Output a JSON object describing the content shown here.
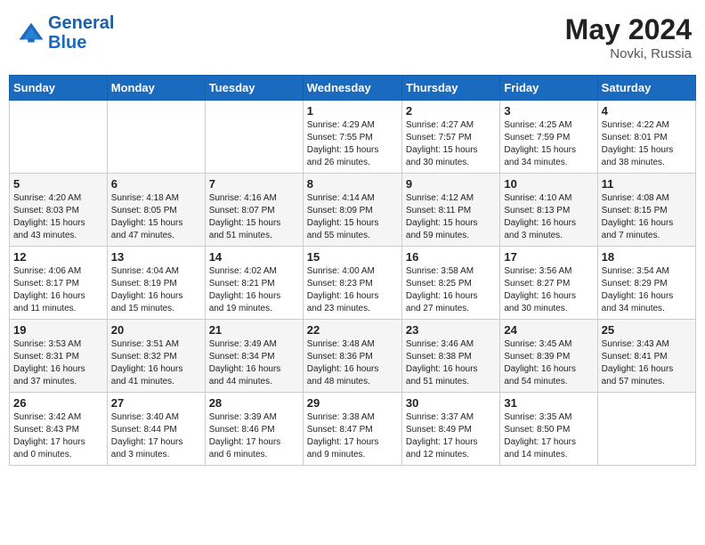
{
  "header": {
    "logo_line1": "General",
    "logo_line2": "Blue",
    "title": "May 2024",
    "subtitle": "Novki, Russia"
  },
  "columns": [
    "Sunday",
    "Monday",
    "Tuesday",
    "Wednesday",
    "Thursday",
    "Friday",
    "Saturday"
  ],
  "weeks": [
    [
      {
        "day": "",
        "info": ""
      },
      {
        "day": "",
        "info": ""
      },
      {
        "day": "",
        "info": ""
      },
      {
        "day": "1",
        "info": "Sunrise: 4:29 AM\nSunset: 7:55 PM\nDaylight: 15 hours\nand 26 minutes."
      },
      {
        "day": "2",
        "info": "Sunrise: 4:27 AM\nSunset: 7:57 PM\nDaylight: 15 hours\nand 30 minutes."
      },
      {
        "day": "3",
        "info": "Sunrise: 4:25 AM\nSunset: 7:59 PM\nDaylight: 15 hours\nand 34 minutes."
      },
      {
        "day": "4",
        "info": "Sunrise: 4:22 AM\nSunset: 8:01 PM\nDaylight: 15 hours\nand 38 minutes."
      }
    ],
    [
      {
        "day": "5",
        "info": "Sunrise: 4:20 AM\nSunset: 8:03 PM\nDaylight: 15 hours\nand 43 minutes."
      },
      {
        "day": "6",
        "info": "Sunrise: 4:18 AM\nSunset: 8:05 PM\nDaylight: 15 hours\nand 47 minutes."
      },
      {
        "day": "7",
        "info": "Sunrise: 4:16 AM\nSunset: 8:07 PM\nDaylight: 15 hours\nand 51 minutes."
      },
      {
        "day": "8",
        "info": "Sunrise: 4:14 AM\nSunset: 8:09 PM\nDaylight: 15 hours\nand 55 minutes."
      },
      {
        "day": "9",
        "info": "Sunrise: 4:12 AM\nSunset: 8:11 PM\nDaylight: 15 hours\nand 59 minutes."
      },
      {
        "day": "10",
        "info": "Sunrise: 4:10 AM\nSunset: 8:13 PM\nDaylight: 16 hours\nand 3 minutes."
      },
      {
        "day": "11",
        "info": "Sunrise: 4:08 AM\nSunset: 8:15 PM\nDaylight: 16 hours\nand 7 minutes."
      }
    ],
    [
      {
        "day": "12",
        "info": "Sunrise: 4:06 AM\nSunset: 8:17 PM\nDaylight: 16 hours\nand 11 minutes."
      },
      {
        "day": "13",
        "info": "Sunrise: 4:04 AM\nSunset: 8:19 PM\nDaylight: 16 hours\nand 15 minutes."
      },
      {
        "day": "14",
        "info": "Sunrise: 4:02 AM\nSunset: 8:21 PM\nDaylight: 16 hours\nand 19 minutes."
      },
      {
        "day": "15",
        "info": "Sunrise: 4:00 AM\nSunset: 8:23 PM\nDaylight: 16 hours\nand 23 minutes."
      },
      {
        "day": "16",
        "info": "Sunrise: 3:58 AM\nSunset: 8:25 PM\nDaylight: 16 hours\nand 27 minutes."
      },
      {
        "day": "17",
        "info": "Sunrise: 3:56 AM\nSunset: 8:27 PM\nDaylight: 16 hours\nand 30 minutes."
      },
      {
        "day": "18",
        "info": "Sunrise: 3:54 AM\nSunset: 8:29 PM\nDaylight: 16 hours\nand 34 minutes."
      }
    ],
    [
      {
        "day": "19",
        "info": "Sunrise: 3:53 AM\nSunset: 8:31 PM\nDaylight: 16 hours\nand 37 minutes."
      },
      {
        "day": "20",
        "info": "Sunrise: 3:51 AM\nSunset: 8:32 PM\nDaylight: 16 hours\nand 41 minutes."
      },
      {
        "day": "21",
        "info": "Sunrise: 3:49 AM\nSunset: 8:34 PM\nDaylight: 16 hours\nand 44 minutes."
      },
      {
        "day": "22",
        "info": "Sunrise: 3:48 AM\nSunset: 8:36 PM\nDaylight: 16 hours\nand 48 minutes."
      },
      {
        "day": "23",
        "info": "Sunrise: 3:46 AM\nSunset: 8:38 PM\nDaylight: 16 hours\nand 51 minutes."
      },
      {
        "day": "24",
        "info": "Sunrise: 3:45 AM\nSunset: 8:39 PM\nDaylight: 16 hours\nand 54 minutes."
      },
      {
        "day": "25",
        "info": "Sunrise: 3:43 AM\nSunset: 8:41 PM\nDaylight: 16 hours\nand 57 minutes."
      }
    ],
    [
      {
        "day": "26",
        "info": "Sunrise: 3:42 AM\nSunset: 8:43 PM\nDaylight: 17 hours\nand 0 minutes."
      },
      {
        "day": "27",
        "info": "Sunrise: 3:40 AM\nSunset: 8:44 PM\nDaylight: 17 hours\nand 3 minutes."
      },
      {
        "day": "28",
        "info": "Sunrise: 3:39 AM\nSunset: 8:46 PM\nDaylight: 17 hours\nand 6 minutes."
      },
      {
        "day": "29",
        "info": "Sunrise: 3:38 AM\nSunset: 8:47 PM\nDaylight: 17 hours\nand 9 minutes."
      },
      {
        "day": "30",
        "info": "Sunrise: 3:37 AM\nSunset: 8:49 PM\nDaylight: 17 hours\nand 12 minutes."
      },
      {
        "day": "31",
        "info": "Sunrise: 3:35 AM\nSunset: 8:50 PM\nDaylight: 17 hours\nand 14 minutes."
      },
      {
        "day": "",
        "info": ""
      }
    ]
  ]
}
